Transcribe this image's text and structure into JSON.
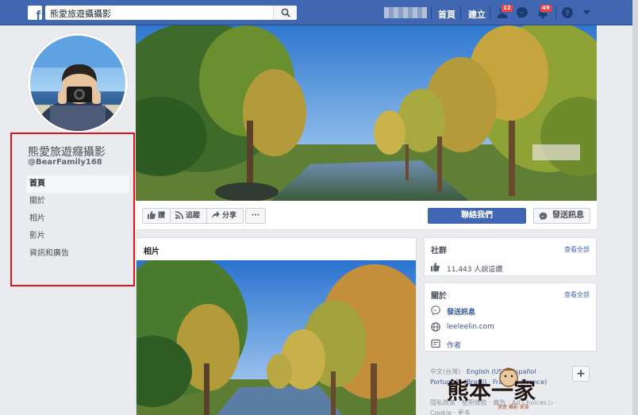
{
  "topbar": {
    "search_value": "熊愛旅遊攝攝影",
    "nav_home": "首頁",
    "nav_create": "建立",
    "friend_requests_count": "12",
    "notifications_count": "49"
  },
  "page": {
    "name": "熊愛旅遊癮攝影",
    "username": "@BearFamily168"
  },
  "leftnav": {
    "items": [
      "首頁",
      "關於",
      "相片",
      "影片",
      "資訊和廣告"
    ]
  },
  "actions": {
    "like": "讚",
    "follow": "追蹤",
    "share": "分享",
    "more": "···",
    "contact": "聯絡我們",
    "send_message": "發送訊息"
  },
  "photos": {
    "title": "相片"
  },
  "community": {
    "title": "社群",
    "see_all": "查看全部",
    "likes_text": "11,443 人說這讚"
  },
  "about": {
    "title": "關於",
    "see_all": "查看全部",
    "message": "發送訊息",
    "website": "leeleelin.com",
    "author": "作者"
  },
  "footer": {
    "lang_current": "中文(台灣)",
    "lang_1": "English (US)",
    "lang_2": "Español",
    "lang_3": "Português (Brasil)",
    "lang_4": "Français (France)",
    "add_language": "+",
    "links": "隱私政策 · 使用條款 · 廣告 · Ad Choices ▷ ·",
    "links2": "Cookie · 更多"
  },
  "watermark": {
    "text": "熊本一家",
    "sub": "旅遊 攝影 美食"
  },
  "colors": {
    "facebook_blue": "#4267b2",
    "highlight_frame": "#e0131a",
    "link_blue": "#365899",
    "badge_red": "#fa3e3e"
  },
  "icons": [
    "search-icon",
    "friend-requests-icon",
    "messenger-icon",
    "notifications-icon",
    "help-icon",
    "dropdown-arrow-icon",
    "like-icon",
    "rss-icon",
    "share-icon",
    "messenger-icon",
    "globe-icon",
    "author-icon"
  ]
}
